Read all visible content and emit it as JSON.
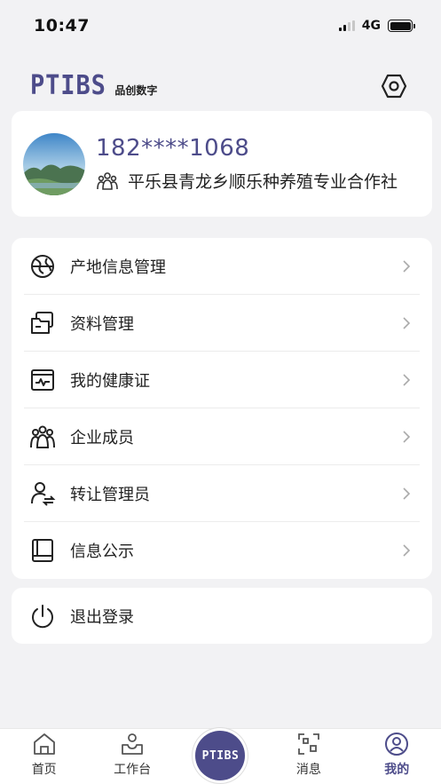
{
  "status_bar": {
    "time": "10:47",
    "network": "4G"
  },
  "header": {
    "logo_text": "PTIBS",
    "logo_subtitle": "品创数字",
    "settings_icon": "hexagon-settings-icon"
  },
  "profile": {
    "phone": "182****1068",
    "organization": "平乐县青龙乡顺乐种养殖专业合作社"
  },
  "menu": {
    "items": [
      {
        "label": "产地信息管理",
        "icon": "globe-origin-icon"
      },
      {
        "label": "资料管理",
        "icon": "folder-icon"
      },
      {
        "label": "我的健康证",
        "icon": "health-certificate-icon"
      },
      {
        "label": "企业成员",
        "icon": "members-icon"
      },
      {
        "label": "转让管理员",
        "icon": "transfer-admin-icon"
      },
      {
        "label": "信息公示",
        "icon": "book-icon"
      }
    ]
  },
  "logout": {
    "label": "退出登录",
    "icon": "power-icon"
  },
  "tab_bar": {
    "items": [
      {
        "label": "首页",
        "icon": "home-icon"
      },
      {
        "label": "工作台",
        "icon": "workbench-icon"
      },
      {
        "label": "PTIBS",
        "icon": "center-logo"
      },
      {
        "label": "消息",
        "icon": "message-icon"
      },
      {
        "label": "我的",
        "icon": "profile-icon"
      }
    ],
    "active": "我的"
  },
  "colors": {
    "accent": "#4d4c8a",
    "background": "#f2f2f4",
    "card": "#ffffff"
  }
}
